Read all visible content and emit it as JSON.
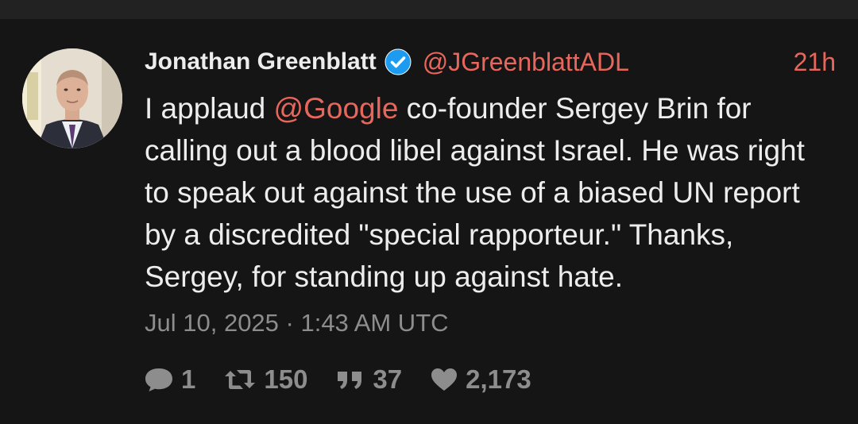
{
  "tweet": {
    "author_name": "Jonathan Greenblatt",
    "handle": "@JGreenblattADL",
    "time_ago": "21h",
    "verified": true,
    "text_before": "I applaud ",
    "mention": "@Google",
    "text_after": " co-founder Sergey Brin for calling out a blood libel against Israel. He was right to speak out against the use of a biased UN report by a discredited \"special rapporteur.\" Thanks, Sergey, for standing up against hate.",
    "date": "Jul 10, 2025 · 1:43 AM UTC"
  },
  "stats": {
    "replies": "1",
    "retweets": "150",
    "quotes": "37",
    "likes": "2,173"
  },
  "colors": {
    "accent": "#e8675c",
    "verified": "#1d9bf0",
    "background": "#151515",
    "muted": "#8d8d8d"
  },
  "icons": {
    "reply": "comment-icon",
    "retweet": "retweet-icon",
    "quote": "quote-icon",
    "like": "heart-icon",
    "verified": "verified-badge-icon"
  }
}
